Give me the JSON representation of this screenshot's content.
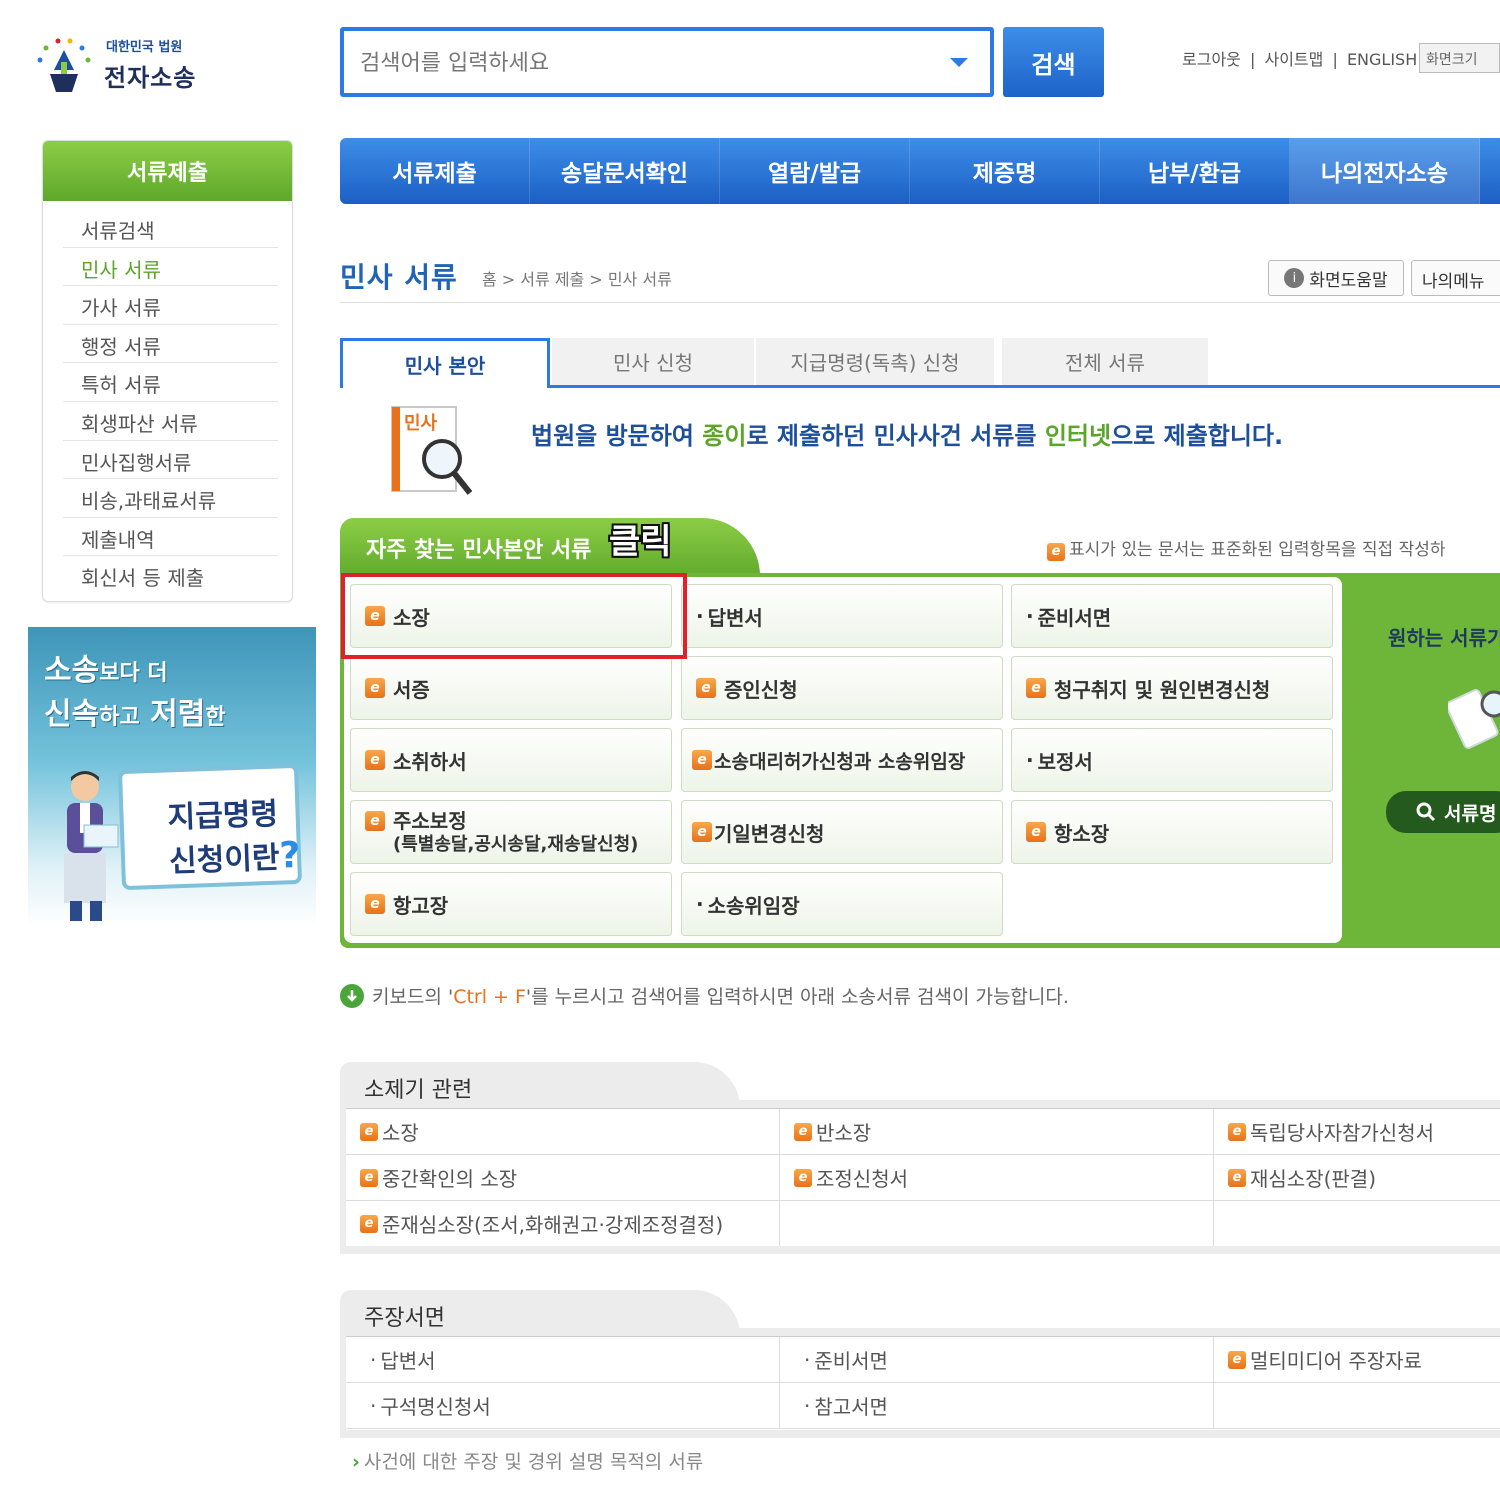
{
  "logo": {
    "small": "대한민국 법원",
    "big": "전자소송"
  },
  "search": {
    "placeholder": "검색어를 입력하세요",
    "button_label": "검색"
  },
  "util": {
    "logout": "로그아웃",
    "sitemap": "사이트맵",
    "english": "ENGLISH",
    "separator": "|",
    "screen_size": "화면크기"
  },
  "sidebar": {
    "title": "서류제출",
    "items": [
      {
        "label": "서류검색"
      },
      {
        "label": "민사 서류"
      },
      {
        "label": "가사 서류"
      },
      {
        "label": "행정 서류"
      },
      {
        "label": "특허 서류"
      },
      {
        "label": "회생파산 서류"
      },
      {
        "label": "민사집행서류"
      },
      {
        "label": "비송,과태료서류"
      },
      {
        "label": "제출내역"
      },
      {
        "label": "회신서 등 제출"
      }
    ],
    "active_index": 1
  },
  "promo": {
    "line1_big_a": "소송",
    "line1_small": "보다 더",
    "line2_big_a": "신속",
    "line2_small_a": "하고",
    "line2_big_b": "저렴",
    "line2_small_b": "한",
    "board_line1": "지급명령",
    "board_line2": "신청이란",
    "board_q": "?"
  },
  "nav": {
    "items": [
      {
        "label": "서류제출"
      },
      {
        "label": "송달문서확인"
      },
      {
        "label": "열람/발급"
      },
      {
        "label": "제증명"
      },
      {
        "label": "납부/환급"
      },
      {
        "label": "나의전자소송"
      }
    ]
  },
  "page": {
    "title": "민사 서류",
    "breadcrumb": "홈 > 서류 제출 > 민사 서류",
    "help_button": "화면도움말",
    "mymenu_button": "나의메뉴"
  },
  "tabs": [
    {
      "label": "민사 본안"
    },
    {
      "label": "민사 신청"
    },
    {
      "label": "지급명령(독촉) 신청"
    },
    {
      "label": "전체 서류"
    }
  ],
  "intro": {
    "icon_label": "민사",
    "part1": "법원을 방문하여 ",
    "paper": "종이",
    "part2": "로 제출하던 민사사건 서류를 ",
    "internet": "인터넷",
    "part3": "으로 제출합니다."
  },
  "frequent": {
    "title": "자주 찾는 민사본안 서류",
    "click_annotation": "클릭",
    "note": "표시가 있는 문서는 표준화된 입력항목을 직접 작성하",
    "docs": [
      {
        "label": "소장",
        "e": true
      },
      {
        "label": "답변서",
        "e": false
      },
      {
        "label": "준비서면",
        "e": false
      },
      {
        "label": "서증",
        "e": true
      },
      {
        "label": "증인신청",
        "e": true
      },
      {
        "label": "청구취지 및 원인변경신청",
        "e": true
      },
      {
        "label": "소취하서",
        "e": true
      },
      {
        "label": "소송대리허가신청과 소송위임장",
        "e": true
      },
      {
        "label": "보정서",
        "e": false
      },
      {
        "label": "주소보정",
        "sub": "(특별송달,공시송달,재송달신청)",
        "e": true
      },
      {
        "label": "기일변경신청",
        "e": true
      },
      {
        "label": "항소장",
        "e": true
      },
      {
        "label": "항고장",
        "e": true
      },
      {
        "label": "소송위임장",
        "e": false
      }
    ],
    "side_label": "원하는 서류가",
    "side_button": "서류명"
  },
  "hint": {
    "before": "키보드의 '",
    "key": "Ctrl + F",
    "after": "'를 누르시고 검색어를 입력하시면 아래 소송서류 검색이 가능합니다."
  },
  "categories": [
    {
      "title": "소제기 관련",
      "rows": [
        [
          {
            "label": "소장",
            "e": true
          },
          {
            "label": "반소장",
            "e": true
          },
          {
            "label": "독립당사자참가신청서",
            "e": true
          }
        ],
        [
          {
            "label": "중간확인의 소장",
            "e": true
          },
          {
            "label": "조정신청서",
            "e": true
          },
          {
            "label": "재심소장(판결)",
            "e": true
          }
        ],
        [
          {
            "label": "준재심소장(조서,화해권고·강제조정결정)",
            "e": true
          },
          {
            "label": "",
            "e": false
          },
          {
            "label": "",
            "e": false
          }
        ]
      ]
    },
    {
      "title": "주장서면",
      "rows": [
        [
          {
            "label": "답변서",
            "e": false
          },
          {
            "label": "준비서면",
            "e": false
          },
          {
            "label": "멀티미디어 주장자료",
            "e": true
          }
        ],
        [
          {
            "label": "구석명신청서",
            "e": false
          },
          {
            "label": "참고서면",
            "e": false
          },
          {
            "label": "",
            "e": false
          }
        ]
      ],
      "footnote": "사건에 대한 주장 및 경위 설명 목적의 서류"
    }
  ],
  "colors": {
    "brand_blue": "#2c7be5",
    "brand_green": "#6db63a",
    "highlight_red": "#e0202a",
    "e_icon_orange": "#e8711a"
  }
}
